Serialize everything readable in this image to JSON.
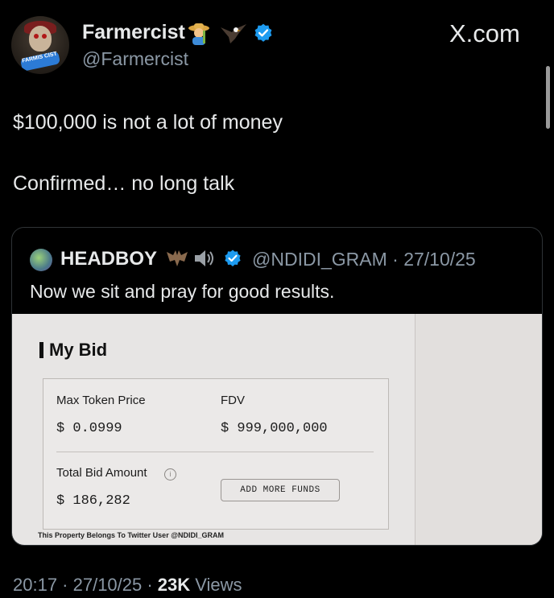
{
  "tweet": {
    "author_name": "Farmercist",
    "author_handle": "@Farmercist",
    "avatar_banner_text": "FARMIS CIST",
    "site_label": "X.com",
    "lines": [
      "$100,000 is not a lot of money",
      "Confirmed… no long talk"
    ],
    "timestamp": "20:17 · 27/10/25 · ",
    "views_count": "23K",
    "views_label": " Views"
  },
  "quote": {
    "author_name": "HEADBOY",
    "meta": "@NDIDI_GRAM · 27/10/25",
    "text": "Now we sit and pray for good results.",
    "image": {
      "title": "My Bid",
      "max_token_price_label": "Max Token Price",
      "max_token_price_value": "$ 0.0999",
      "fdv_label": "FDV",
      "fdv_value": "$ 999,000,000",
      "total_bid_label": "Total Bid Amount",
      "total_bid_value": "$ 186,282",
      "add_funds_label": "ADD MORE FUNDS",
      "watermark": "This Property Belongs To Twitter User @NDIDI_GRAM"
    }
  },
  "colors": {
    "verified": "#1d9bf0",
    "muted": "#8b98a5",
    "text": "#e7e9ea",
    "background": "#000000"
  },
  "icons": [
    "farmer-emoji-icon",
    "eagle-emoji-icon",
    "verified-badge-icon",
    "bat-emoji-icon",
    "speaker-emoji-icon",
    "info-icon"
  ]
}
